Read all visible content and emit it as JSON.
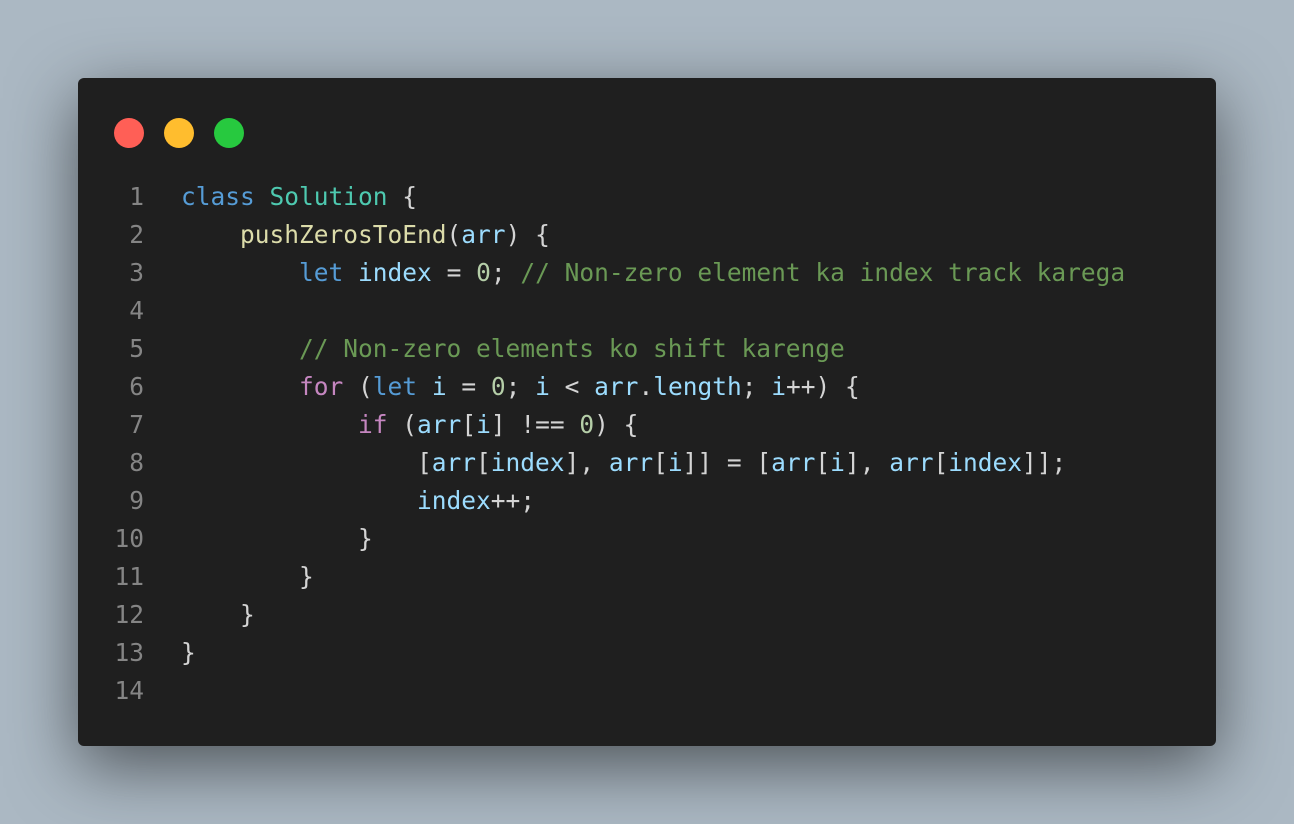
{
  "window": {
    "controls": [
      {
        "name": "close",
        "color": "#ff5f56"
      },
      {
        "name": "minimize",
        "color": "#ffbd2e"
      },
      {
        "name": "maximize",
        "color": "#27c93f"
      }
    ]
  },
  "code": {
    "language": "javascript",
    "lines": [
      {
        "number": "1",
        "tokens": [
          {
            "text": "class",
            "type": "keyword"
          },
          {
            "text": " ",
            "type": "punct"
          },
          {
            "text": "Solution",
            "type": "class"
          },
          {
            "text": " {",
            "type": "punct"
          }
        ]
      },
      {
        "number": "2",
        "tokens": [
          {
            "text": "    ",
            "type": "punct"
          },
          {
            "text": "pushZerosToEnd",
            "type": "func"
          },
          {
            "text": "(",
            "type": "punct"
          },
          {
            "text": "arr",
            "type": "var"
          },
          {
            "text": ") {",
            "type": "punct"
          }
        ]
      },
      {
        "number": "3",
        "tokens": [
          {
            "text": "        ",
            "type": "punct"
          },
          {
            "text": "let",
            "type": "keyword"
          },
          {
            "text": " ",
            "type": "punct"
          },
          {
            "text": "index",
            "type": "var"
          },
          {
            "text": " = ",
            "type": "punct"
          },
          {
            "text": "0",
            "type": "num"
          },
          {
            "text": "; ",
            "type": "punct"
          },
          {
            "text": "// Non-zero element ka index track karega",
            "type": "comment"
          }
        ]
      },
      {
        "number": "4",
        "tokens": []
      },
      {
        "number": "5",
        "tokens": [
          {
            "text": "        ",
            "type": "punct"
          },
          {
            "text": "// Non-zero elements ko shift karenge",
            "type": "comment"
          }
        ]
      },
      {
        "number": "6",
        "tokens": [
          {
            "text": "        ",
            "type": "punct"
          },
          {
            "text": "for",
            "type": "control"
          },
          {
            "text": " (",
            "type": "punct"
          },
          {
            "text": "let",
            "type": "keyword"
          },
          {
            "text": " ",
            "type": "punct"
          },
          {
            "text": "i",
            "type": "var"
          },
          {
            "text": " = ",
            "type": "punct"
          },
          {
            "text": "0",
            "type": "num"
          },
          {
            "text": "; ",
            "type": "punct"
          },
          {
            "text": "i",
            "type": "var"
          },
          {
            "text": " < ",
            "type": "punct"
          },
          {
            "text": "arr",
            "type": "var"
          },
          {
            "text": ".",
            "type": "punct"
          },
          {
            "text": "length",
            "type": "var"
          },
          {
            "text": "; ",
            "type": "punct"
          },
          {
            "text": "i",
            "type": "var"
          },
          {
            "text": "++) {",
            "type": "punct"
          }
        ]
      },
      {
        "number": "7",
        "tokens": [
          {
            "text": "            ",
            "type": "punct"
          },
          {
            "text": "if",
            "type": "control"
          },
          {
            "text": " (",
            "type": "punct"
          },
          {
            "text": "arr",
            "type": "var"
          },
          {
            "text": "[",
            "type": "punct"
          },
          {
            "text": "i",
            "type": "var"
          },
          {
            "text": "] !== ",
            "type": "punct"
          },
          {
            "text": "0",
            "type": "num"
          },
          {
            "text": ") {",
            "type": "punct"
          }
        ]
      },
      {
        "number": "8",
        "tokens": [
          {
            "text": "                [",
            "type": "punct"
          },
          {
            "text": "arr",
            "type": "var"
          },
          {
            "text": "[",
            "type": "punct"
          },
          {
            "text": "index",
            "type": "var"
          },
          {
            "text": "], ",
            "type": "punct"
          },
          {
            "text": "arr",
            "type": "var"
          },
          {
            "text": "[",
            "type": "punct"
          },
          {
            "text": "i",
            "type": "var"
          },
          {
            "text": "]] = [",
            "type": "punct"
          },
          {
            "text": "arr",
            "type": "var"
          },
          {
            "text": "[",
            "type": "punct"
          },
          {
            "text": "i",
            "type": "var"
          },
          {
            "text": "], ",
            "type": "punct"
          },
          {
            "text": "arr",
            "type": "var"
          },
          {
            "text": "[",
            "type": "punct"
          },
          {
            "text": "index",
            "type": "var"
          },
          {
            "text": "]];",
            "type": "punct"
          }
        ]
      },
      {
        "number": "9",
        "tokens": [
          {
            "text": "                ",
            "type": "punct"
          },
          {
            "text": "index",
            "type": "var"
          },
          {
            "text": "++;",
            "type": "punct"
          }
        ]
      },
      {
        "number": "10",
        "tokens": [
          {
            "text": "            }",
            "type": "punct"
          }
        ]
      },
      {
        "number": "11",
        "tokens": [
          {
            "text": "        }",
            "type": "punct"
          }
        ]
      },
      {
        "number": "12",
        "tokens": [
          {
            "text": "    }",
            "type": "punct"
          }
        ]
      },
      {
        "number": "13",
        "tokens": [
          {
            "text": "}",
            "type": "punct"
          }
        ]
      },
      {
        "number": "14",
        "tokens": []
      }
    ]
  }
}
